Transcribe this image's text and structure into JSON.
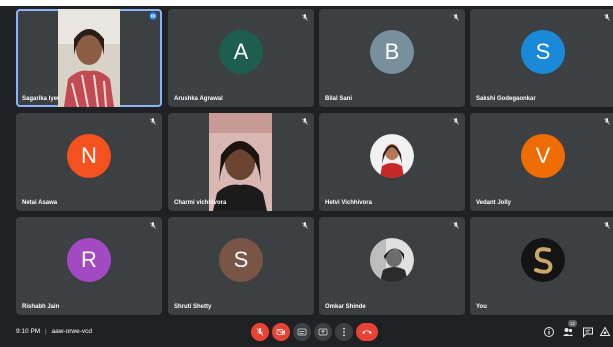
{
  "participants": [
    {
      "name": "Sagarika Iyer",
      "type": "video",
      "active": true
    },
    {
      "name": "Arushka Agrawal",
      "initial": "A",
      "color": "#1e5e4e"
    },
    {
      "name": "Bilal Sani",
      "initial": "B",
      "color": "#78909c"
    },
    {
      "name": "Sakshi Godegaonkar",
      "initial": "S",
      "color": "#1a8ad8"
    },
    {
      "name": "Netai Asawa",
      "initial": "N",
      "color": "#f4511e"
    },
    {
      "name": "Charmi vichhivora",
      "type": "video"
    },
    {
      "name": "Hetvi Vichhivora",
      "type": "photo"
    },
    {
      "name": "Vedant Jolly",
      "initial": "V",
      "color": "#ef6c00"
    },
    {
      "name": "Rishabh Jain",
      "initial": "R",
      "color": "#a349c2"
    },
    {
      "name": "Shruti Shetty",
      "initial": "S",
      "color": "#795548"
    },
    {
      "name": "Omkar Shinde",
      "type": "photo"
    },
    {
      "name": "You",
      "type": "photo"
    }
  ],
  "meeting": {
    "time": "9:10 PM",
    "separator": "|",
    "code": "aaw-orwe-vcd",
    "participant_count": "12"
  },
  "colors": {
    "background": "#202124",
    "tile": "#3c4043",
    "accent": "#8ab4f8",
    "danger": "#ea4335"
  },
  "controls": {
    "mic": "mic-off-icon",
    "camera": "camera-off-icon",
    "captions": "captions-icon",
    "present": "present-icon",
    "more": "more-vert-icon",
    "leave": "call-end-icon"
  }
}
